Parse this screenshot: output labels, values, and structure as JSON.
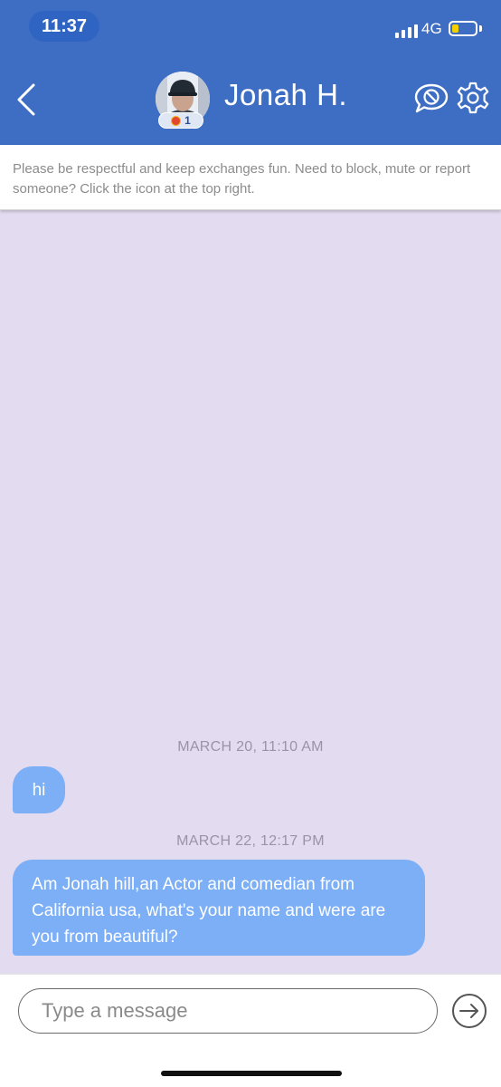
{
  "status_bar": {
    "time": "11:37",
    "network": "4G",
    "signal_icon": "cellular-signal-icon",
    "battery_icon": "battery-low-icon",
    "battery_color": "#f5d000"
  },
  "header": {
    "background": "#3d6ec3",
    "back_icon": "chevron-left-icon",
    "contact_name": "Jonah H.",
    "avatar_badge_count": "1",
    "block_icon": "block-chat-icon",
    "settings_icon": "gear-icon"
  },
  "notice": {
    "text": "Please be respectful and keep exchanges fun. Need to block, mute or report someone? Click the icon at the top right."
  },
  "chat": {
    "background": "#e3dbef",
    "bubble_color": "#7daff7",
    "messages": [
      {
        "date": "MARCH 20, 11:10 AM",
        "text": "hi"
      },
      {
        "date": "MARCH 22, 12:17 PM",
        "text": "Am Jonah hill,an Actor and comedian from California usa, what's your name and were are you from beautiful?"
      }
    ]
  },
  "composer": {
    "placeholder": "Type a message",
    "value": "",
    "send_icon": "send-arrow-icon"
  }
}
